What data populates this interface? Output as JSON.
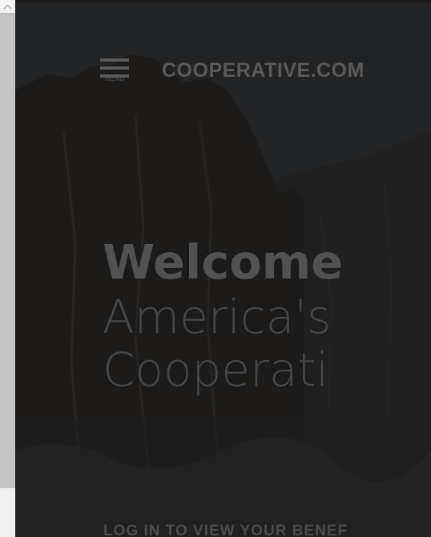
{
  "header": {
    "menu_label": "MENU",
    "brand": "COOPERATIVE.COM"
  },
  "hero": {
    "headline_line1": "Welcome",
    "headline_line2": "America's",
    "headline_line3": "Cooperati",
    "cta": "LOG IN TO VIEW YOUR BENEF"
  },
  "icons": {
    "menu": "hamburger-icon",
    "scroll_up": "chevron-up-icon"
  }
}
